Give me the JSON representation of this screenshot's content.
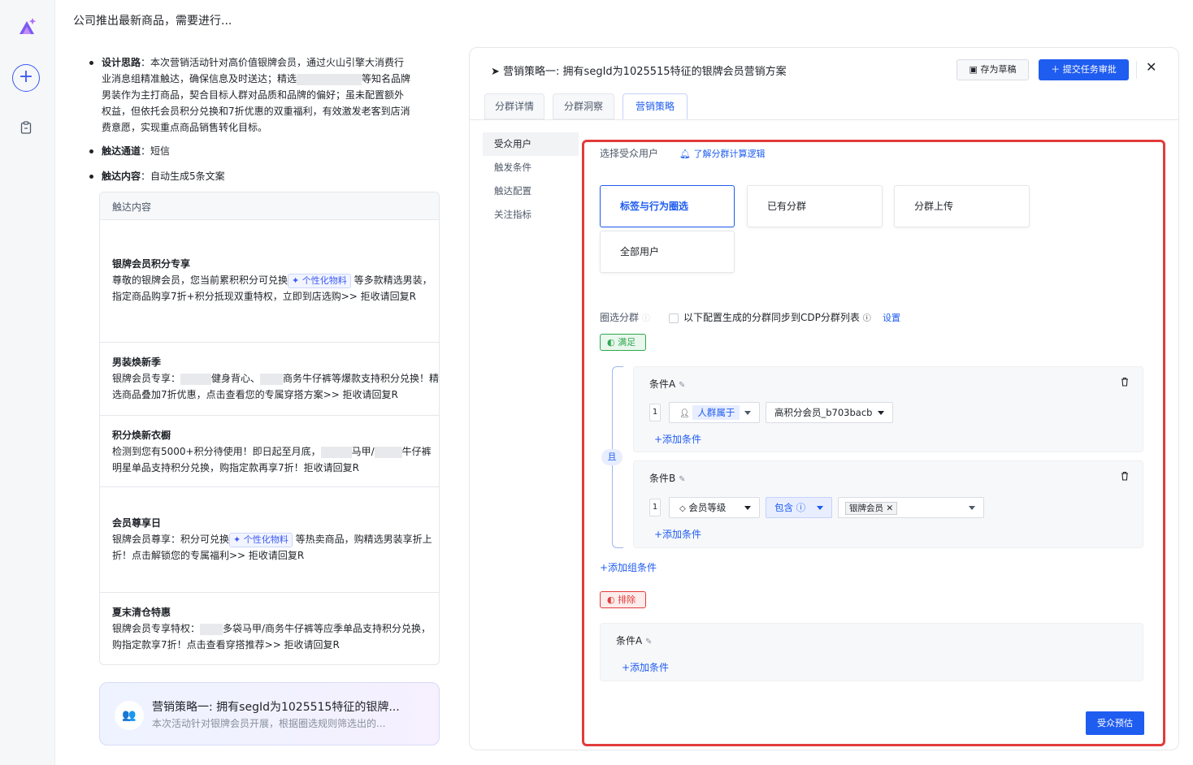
{
  "page_title": "公司推出最新商品，需要进行...",
  "left": {
    "bullets": [
      {
        "label": "设计思路",
        "lines": [
          "：本次营销活动针对高价值银牌会员，通过火山引擎大消费行",
          "业消息组精准触达，确保信息及时送达；精选",
          "等知名品牌",
          "男装作为主打商品，契合目标人群对品质和品牌的偏好；虽未配置额外",
          "权益，但依托会员积分兑换和7折优惠的双重福利，有效激发老客到店消",
          "费意愿，实现重点商品销售转化目标。"
        ]
      },
      {
        "label": "触达通道",
        "text": "：短信"
      },
      {
        "label": "触达内容",
        "text": "：自动生成5条文案"
      }
    ],
    "content_header": "触达内容",
    "personalize_tag": "个性化物料",
    "messages": [
      {
        "title": "银牌会员积分专享",
        "l1a": "尊敬的银牌会员，您当前累积积分可兑换",
        "l1b": "等多款精选男装，",
        "l2": "指定商品购享7折+积分抵现双重特权，立即到店选购>> 拒收请回复R"
      },
      {
        "title": "男装焕新季",
        "l1a": "银牌会员专享：",
        "l1b": "健身背心、",
        "l1c": "商务牛仔裤等爆款支持积分兑换！精",
        "l2": "选商品叠加7折优惠，点击查看您的专属穿搭方案>> 拒收请回复R"
      },
      {
        "title": "积分焕新衣橱",
        "l1a": "检测到您有5000+积分待使用！即日起至月底，",
        "l1b": "马甲/",
        "l1c": "牛仔裤",
        "l2": "明星单品支持积分兑换，购指定款再享7折！拒收请回复R"
      },
      {
        "title": "会员尊享日",
        "l1a": "银牌会员尊享：积分可兑换",
        "l1b": "等热卖商品，购精选男装享折上",
        "l2": "折！点击解锁您的专属福利>> 拒收请回复R"
      },
      {
        "title": "夏末清仓特惠",
        "l1a": "银牌会员专享特权：",
        "l1b": "多袋马甲/商务牛仔裤等应季单品支持积分兑换，",
        "l2": "购指定款享7折！点击查看穿搭推荐>> 拒收请回复R"
      }
    ],
    "strategy_card": {
      "title": "营销策略一: 拥有segId为1025515特征的银牌...",
      "desc": "本次活动针对银牌会员开展，根据圈选规则筛选出的..."
    }
  },
  "panel": {
    "title": "营销策略一: 拥有segId为1025515特征的银牌会员营销方案",
    "draft_label": "存为草稿",
    "submit_label": "提交任务审批",
    "tabs": [
      "分群详情",
      "分群洞察",
      "营销策略"
    ],
    "active_tab": "营销策略",
    "side_items": [
      "受众用户",
      "触发条件",
      "触达配置",
      "关注指标"
    ],
    "select_label": "选择受众用户",
    "learn_link": "了解分群计算逻辑",
    "options": [
      "标签与行为圈选",
      "已有分群",
      "分群上传",
      "全部用户"
    ],
    "circle_label": "圈选分群",
    "sync_text": "以下配置生成的分群同步到CDP分群列表",
    "settings_link": "设置",
    "satisfy_badge": "满足",
    "and_label": "且",
    "cond_a": {
      "title": "条件A",
      "num": "1",
      "field": "人群属于",
      "value": "高积分会员_b703bacb",
      "add": "+添加条件"
    },
    "cond_b": {
      "title": "条件B",
      "num": "1",
      "field": "会员等级",
      "op": "包含",
      "chip": "银牌会员",
      "add": "+添加条件"
    },
    "add_group": "+添加组条件",
    "exclude_badge": "排除",
    "ex_cond": {
      "title": "条件A",
      "add": "+添加条件"
    },
    "estimate_btn": "受众预估"
  },
  "colors": {
    "accent": "#1f5cf0",
    "highlight": "#e23b3b",
    "ok": "#2fa84f"
  }
}
